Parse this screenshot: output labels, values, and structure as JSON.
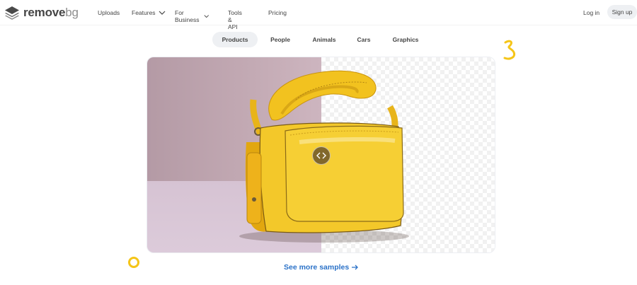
{
  "header": {
    "logo": {
      "word": "remove",
      "suffix": "bg"
    },
    "nav": [
      {
        "label": "Uploads",
        "dropdown": false
      },
      {
        "label": "Features",
        "dropdown": true
      },
      {
        "label": "For Business",
        "dropdown": true
      },
      {
        "label": "Tools & API",
        "dropdown": false
      },
      {
        "label": "Pricing",
        "dropdown": false
      }
    ],
    "login_label": "Log in",
    "signup_label": "Sign up"
  },
  "tabs": [
    {
      "label": "Products",
      "active": true
    },
    {
      "label": "People",
      "active": false
    },
    {
      "label": "Animals",
      "active": false
    },
    {
      "label": "Cars",
      "active": false
    },
    {
      "label": "Graphics",
      "active": false
    }
  ],
  "sample": {
    "subject": "yellow handbag",
    "slider_icon": "chevron-left-right-icon"
  },
  "see_more": {
    "label": "See more samples",
    "icon": "arrow-right-icon"
  },
  "colors": {
    "accent_link": "#2b72c8",
    "decoration_yellow": "#f5c518",
    "pill_bg": "#eef0f3",
    "text": "#454545"
  }
}
